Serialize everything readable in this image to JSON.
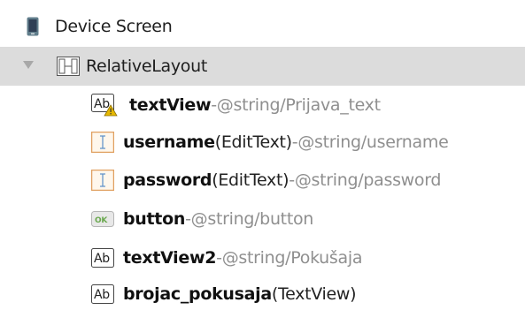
{
  "tree": {
    "root": {
      "label": "Device Screen",
      "icon": "device-screen-icon"
    },
    "layout": {
      "label": "RelativeLayout",
      "icon": "relative-layout-icon",
      "expanded": true
    },
    "children": [
      {
        "name": "textView",
        "type": "",
        "separator": " - ",
        "ref": "@string/Prijava_text",
        "icon": "textview-warning-icon",
        "icon_text": "Ab"
      },
      {
        "name": "username",
        "type": " (EditText)",
        "separator": " - ",
        "ref": "@string/username",
        "icon": "edittext-icon",
        "icon_text": "I"
      },
      {
        "name": "password",
        "type": " (EditText)",
        "separator": " - ",
        "ref": "@string/password",
        "icon": "edittext-icon",
        "icon_text": "I"
      },
      {
        "name": "button",
        "type": "",
        "separator": " - ",
        "ref": "@string/button",
        "icon": "button-icon",
        "icon_text": "OK"
      },
      {
        "name": "textView2",
        "type": "",
        "separator": " - ",
        "ref": "@string/Pokušaja",
        "icon": "textview-icon",
        "icon_text": "Ab"
      },
      {
        "name": "brojac_pokusaja",
        "type": " (TextView)",
        "separator": "",
        "ref": "",
        "icon": "textview-icon",
        "icon_text": "Ab"
      }
    ]
  },
  "colors": {
    "selected_row": "#dcdcdc",
    "reference_text": "#8f8f8f",
    "edittext_icon": "#e0a060",
    "button_icon": "#6aa84f",
    "warning": "#e6b800"
  }
}
